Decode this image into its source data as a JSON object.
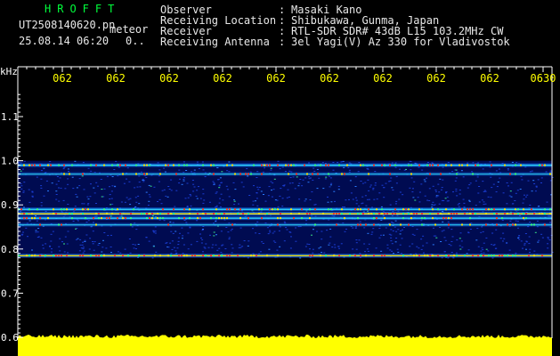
{
  "header": {
    "brand": "HROFFT",
    "filename": "UT2508140620.pn",
    "mode": "meteor",
    "datetime": "25.08.14 06:20",
    "counter": "0..",
    "fields": [
      {
        "label": "Observer",
        "value": "Masaki Kano"
      },
      {
        "label": "Receiving Location",
        "value": "Shibukawa, Gunma, Japan"
      },
      {
        "label": "Receiver",
        "value": "RTL-SDR SDR# 43dB L15 103.2MHz CW"
      },
      {
        "label": "Receiving Antenna",
        "value": "3el Yagi(V) Az 330 for Vladivostok"
      }
    ]
  },
  "colors": {
    "background": "#000000",
    "frame": "#ffffff",
    "axis_text": "#ffffff",
    "time_text": "#ffff00",
    "brand_text": "#00ff3c",
    "header_text": "#e8e8e8",
    "noise_floor": "#ffff00",
    "noise_base": "#000c5a"
  },
  "chart_data": {
    "type": "heatmap",
    "title": "",
    "ylabel": "kHz",
    "xlabel": "",
    "x_ticks": [
      "062",
      "062",
      "062",
      "062",
      "062",
      "062",
      "062",
      "062",
      "062",
      "0630"
    ],
    "y_ticks": [
      "1.1",
      "1.0",
      "0.9",
      "0.8",
      "0.7",
      "0.6"
    ],
    "ylim": [
      0.6,
      1.15
    ],
    "noise_band": [
      0.78,
      1.0
    ],
    "signal_lines": [
      {
        "freq_khz": 0.99,
        "strength": 0.75
      },
      {
        "freq_khz": 0.97,
        "strength": 0.3
      },
      {
        "freq_khz": 0.89,
        "strength": 0.7
      },
      {
        "freq_khz": 0.88,
        "strength": 1.0
      },
      {
        "freq_khz": 0.87,
        "strength": 0.65
      },
      {
        "freq_khz": 0.855,
        "strength": 0.35
      },
      {
        "freq_khz": 0.785,
        "strength": 0.85
      }
    ],
    "grid": false
  }
}
